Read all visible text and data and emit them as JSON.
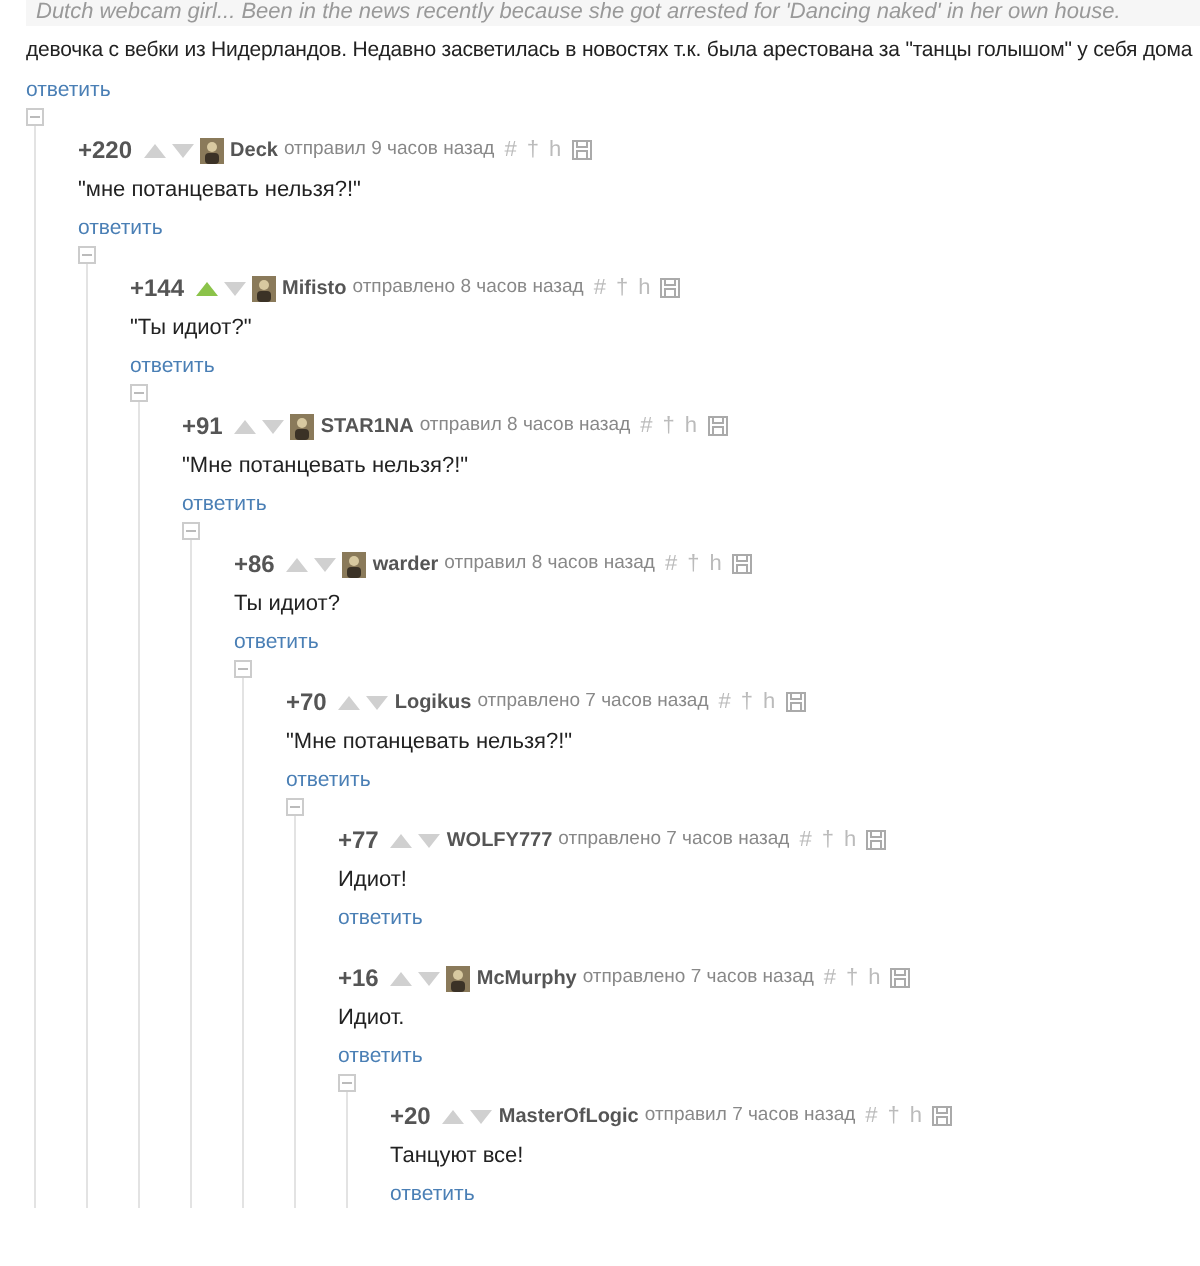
{
  "post": {
    "caption": "Dutch webcam girl... Been in the news recently because she got arrested for 'Dancing naked' in her own house.",
    "text": "девочка с вебки из Нидерландов. Недавно засветилась в новостях т.к. была арестована за \"танцы голышом\" у себя дома",
    "reply": "ответить"
  },
  "comments": [
    {
      "score": "+220",
      "upvoted": false,
      "avatar": true,
      "author": "Deck",
      "verb": "отправил",
      "time": "9 часов назад",
      "actions": [
        "#",
        "†",
        "h"
      ],
      "text": "\"мне потанцевать нельзя?!\"",
      "reply": "ответить",
      "children": [
        {
          "score": "+144",
          "upvoted": true,
          "avatar": true,
          "author": "Mifisto",
          "verb": "отправлено",
          "time": "8 часов назад",
          "actions": [
            "#",
            "†",
            "h"
          ],
          "text": "\"Ты идиот?\"",
          "reply": "ответить",
          "children": [
            {
              "score": "+91",
              "upvoted": false,
              "avatar": true,
              "author": "STAR1NA",
              "verb": "отправил",
              "time": "8 часов назад",
              "actions": [
                "#",
                "†",
                "h"
              ],
              "text": "\"Мне потанцевать нельзя?!\"",
              "reply": "ответить",
              "children": [
                {
                  "score": "+86",
                  "upvoted": false,
                  "avatar": true,
                  "author": "warder",
                  "verb": "отправил",
                  "time": "8 часов назад",
                  "actions": [
                    "#",
                    "†",
                    "h"
                  ],
                  "text": "Ты идиот?",
                  "reply": "ответить",
                  "children": [
                    {
                      "score": "+70",
                      "upvoted": false,
                      "avatar": false,
                      "author": "Logikus",
                      "verb": "отправлено",
                      "time": "7 часов назад",
                      "actions": [
                        "#",
                        "†",
                        "h"
                      ],
                      "text": "\"Мне потанцевать нельзя?!\"",
                      "reply": "ответить",
                      "children": [
                        {
                          "score": "+77",
                          "upvoted": false,
                          "avatar": false,
                          "author": "WOLFY777",
                          "verb": "отправлено",
                          "time": "7 часов назад",
                          "actions": [
                            "#",
                            "†",
                            "h"
                          ],
                          "text": "Идиот!",
                          "reply": "ответить"
                        },
                        {
                          "score": "+16",
                          "upvoted": false,
                          "avatar": true,
                          "author": "McMurphy",
                          "verb": "отправлено",
                          "time": "7 часов назад",
                          "actions": [
                            "#",
                            "†",
                            "h"
                          ],
                          "text": "Идиот.",
                          "reply": "ответить",
                          "children": [
                            {
                              "score": "+20",
                              "upvoted": false,
                              "avatar": false,
                              "author": "MasterOfLogic",
                              "verb": "отправил",
                              "time": "7 часов назад",
                              "actions": [
                                "#",
                                "†",
                                "h"
                              ],
                              "text": "Танцуют все!",
                              "reply": "ответить"
                            }
                          ]
                        }
                      ]
                    }
                  ]
                }
              ]
            }
          ]
        }
      ]
    }
  ]
}
